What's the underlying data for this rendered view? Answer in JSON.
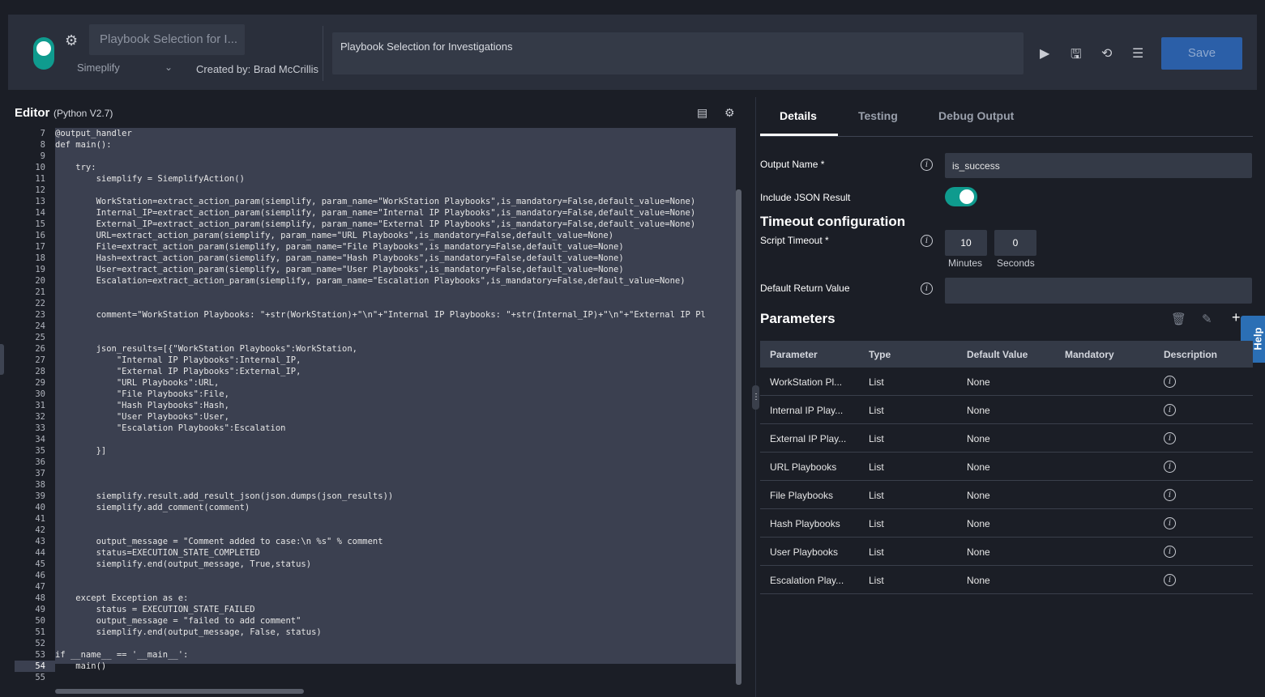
{
  "header": {
    "playbook_name_short": "Playbook Selection for I...",
    "environment": "Simeplify",
    "created_by": "Created by: Brad McCrillis",
    "description": "Playbook Selection for Investigations",
    "save_label": "Save",
    "icons": [
      "gear-icon",
      "play-icon",
      "save-file-icon",
      "history-icon",
      "list-icon"
    ]
  },
  "editor": {
    "title": "Editor",
    "language": "(Python V2.7)",
    "line_numbers": [
      "7",
      "8",
      "9",
      "10",
      "11",
      "12",
      "13",
      "14",
      "15",
      "16",
      "17",
      "18",
      "19",
      "20",
      "21",
      "22",
      "23",
      "24",
      "25",
      "26",
      "27",
      "28",
      "29",
      "30",
      "31",
      "32",
      "33",
      "34",
      "35",
      "36",
      "37",
      "38",
      "39",
      "40",
      "41",
      "42",
      "43",
      "44",
      "45",
      "46",
      "47",
      "48",
      "49",
      "50",
      "51",
      "52",
      "53",
      "54",
      "55"
    ],
    "lines": [
      "@output_handler",
      "def main():",
      "",
      "    try:",
      "        siemplify = SiemplifyAction()",
      "",
      "        WorkStation=extract_action_param(siemplify, param_name=\"WorkStation Playbooks\",is_mandatory=False,default_value=None)",
      "        Internal_IP=extract_action_param(siemplify, param_name=\"Internal IP Playbooks\",is_mandatory=False,default_value=None)",
      "        External_IP=extract_action_param(siemplify, param_name=\"External IP Playbooks\",is_mandatory=False,default_value=None)",
      "        URL=extract_action_param(siemplify, param_name=\"URL Playbooks\",is_mandatory=False,default_value=None)",
      "        File=extract_action_param(siemplify, param_name=\"File Playbooks\",is_mandatory=False,default_value=None)",
      "        Hash=extract_action_param(siemplify, param_name=\"Hash Playbooks\",is_mandatory=False,default_value=None)",
      "        User=extract_action_param(siemplify, param_name=\"User Playbooks\",is_mandatory=False,default_value=None)",
      "        Escalation=extract_action_param(siemplify, param_name=\"Escalation Playbooks\",is_mandatory=False,default_value=None)",
      "",
      "",
      "        comment=\"WorkStation Playbooks: \"+str(WorkStation)+\"\\n\"+\"Internal IP Playbooks: \"+str(Internal_IP)+\"\\n\"+\"External IP Pl",
      "",
      "",
      "        json_results=[{\"WorkStation Playbooks\":WorkStation,",
      "            \"Internal IP Playbooks\":Internal_IP,",
      "            \"External IP Playbooks\":External_IP,",
      "            \"URL Playbooks\":URL,",
      "            \"File Playbooks\":File,",
      "            \"Hash Playbooks\":Hash,",
      "            \"User Playbooks\":User,",
      "            \"Escalation Playbooks\":Escalation",
      "",
      "        }]",
      "",
      "",
      "",
      "        siemplify.result.add_result_json(json.dumps(json_results))",
      "        siemplify.add_comment(comment)",
      "",
      "",
      "        output_message = \"Comment added to case:\\n %s\" % comment",
      "        status=EXECUTION_STATE_COMPLETED",
      "        siemplify.end(output_message, True,status)",
      "",
      "",
      "    except Exception as e:",
      "        status = EXECUTION_STATE_FAILED",
      "        output_message = \"failed to add comment\"",
      "        siemplify.end(output_message, False, status)",
      "",
      "if __name__ == '__main__':",
      "    main()",
      ""
    ]
  },
  "tabs": [
    "Details",
    "Testing",
    "Debug Output"
  ],
  "details": {
    "output_name_label": "Output Name *",
    "output_name_value": "is_success",
    "include_json_label": "Include JSON Result",
    "include_json_on": true,
    "timeout_title": "Timeout configuration",
    "script_timeout_label": "Script Timeout *",
    "minutes_value": "10",
    "seconds_value": "0",
    "minutes_label": "Minutes",
    "seconds_label": "Seconds",
    "default_return_label": "Default Return Value",
    "default_return_value": "",
    "parameters_title": "Parameters",
    "help_label": "Help"
  },
  "parameters": {
    "columns": [
      "Parameter",
      "Type",
      "Default Value",
      "Mandatory",
      "Description"
    ],
    "rows": [
      {
        "name": "WorkStation Pl...",
        "type": "List",
        "default": "None",
        "mandatory": ""
      },
      {
        "name": "Internal IP Play...",
        "type": "List",
        "default": "None",
        "mandatory": ""
      },
      {
        "name": "External IP Play...",
        "type": "List",
        "default": "None",
        "mandatory": ""
      },
      {
        "name": "URL Playbooks",
        "type": "List",
        "default": "None",
        "mandatory": ""
      },
      {
        "name": "File Playbooks",
        "type": "List",
        "default": "None",
        "mandatory": ""
      },
      {
        "name": "Hash Playbooks",
        "type": "List",
        "default": "None",
        "mandatory": ""
      },
      {
        "name": "User Playbooks",
        "type": "List",
        "default": "None",
        "mandatory": ""
      },
      {
        "name": "Escalation Play...",
        "type": "List",
        "default": "None",
        "mandatory": ""
      }
    ]
  }
}
